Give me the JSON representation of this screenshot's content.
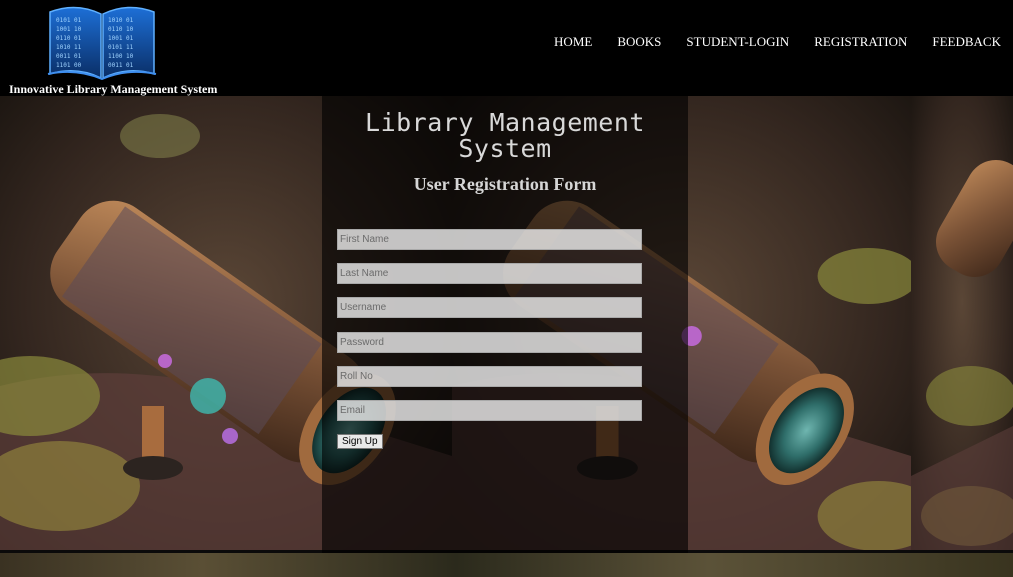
{
  "brand": {
    "name": "Innovative Library Management System"
  },
  "nav": [
    "HOME",
    "BOOKS",
    "STUDENT-LOGIN",
    "REGISTRATION",
    "FEEDBACK"
  ],
  "form": {
    "title": "Library Management System",
    "subtitle": "User Registration Form",
    "fields": [
      {
        "placeholder": "First Name"
      },
      {
        "placeholder": "Last Name"
      },
      {
        "placeholder": "Username"
      },
      {
        "placeholder": "Password"
      },
      {
        "placeholder": "Roll No"
      },
      {
        "placeholder": "Email"
      }
    ],
    "submit_label": "Sign Up"
  },
  "colors": {
    "header_bg": "#000000",
    "nav_text": "#ffffff",
    "panel_overlay": "rgba(0,0,0,0.62)"
  }
}
